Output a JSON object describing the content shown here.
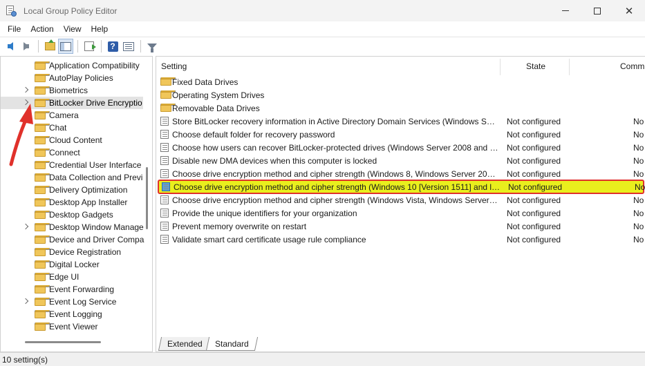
{
  "window": {
    "title": "Local Group Policy Editor",
    "controls": [
      "minimize",
      "maximize",
      "close"
    ]
  },
  "menu": [
    "File",
    "Action",
    "View",
    "Help"
  ],
  "toolbar": {
    "buttons": [
      "back-icon",
      "forward-icon",
      "up-folder-icon",
      "show-hide-tree-icon",
      "export-list-icon",
      "help-icon",
      "view-icon",
      "filter-icon"
    ]
  },
  "tree": {
    "items": [
      {
        "label": "Application Compatibility",
        "expandable": false
      },
      {
        "label": "AutoPlay Policies",
        "expandable": false
      },
      {
        "label": "Biometrics",
        "expandable": true
      },
      {
        "label": "BitLocker Drive Encryptio",
        "expandable": true,
        "selected": true
      },
      {
        "label": "Camera",
        "expandable": false
      },
      {
        "label": "Chat",
        "expandable": false
      },
      {
        "label": "Cloud Content",
        "expandable": false
      },
      {
        "label": "Connect",
        "expandable": false
      },
      {
        "label": "Credential User Interface",
        "expandable": false
      },
      {
        "label": "Data Collection and Previ",
        "expandable": false
      },
      {
        "label": "Delivery Optimization",
        "expandable": false
      },
      {
        "label": "Desktop App Installer",
        "expandable": false
      },
      {
        "label": "Desktop Gadgets",
        "expandable": false
      },
      {
        "label": "Desktop Window Manage",
        "expandable": true
      },
      {
        "label": "Device and Driver Compa",
        "expandable": false
      },
      {
        "label": "Device Registration",
        "expandable": false
      },
      {
        "label": "Digital Locker",
        "expandable": false
      },
      {
        "label": "Edge UI",
        "expandable": false
      },
      {
        "label": "Event Forwarding",
        "expandable": false
      },
      {
        "label": "Event Log Service",
        "expandable": true
      },
      {
        "label": "Event Logging",
        "expandable": false
      },
      {
        "label": "Event Viewer",
        "expandable": false
      }
    ]
  },
  "list": {
    "columns": {
      "setting": "Setting",
      "state": "State",
      "comment": "Comm"
    },
    "rows": [
      {
        "name": "Fixed Data Drives",
        "state": "",
        "comment": "",
        "type": "folder"
      },
      {
        "name": "Operating System Drives",
        "state": "",
        "comment": "",
        "type": "folder"
      },
      {
        "name": "Removable Data Drives",
        "state": "",
        "comment": "",
        "type": "folder"
      },
      {
        "name": "Store BitLocker recovery information in Active Directory Domain Services (Windows Serv...",
        "state": "Not configured",
        "comment": "No",
        "type": "setting"
      },
      {
        "name": "Choose default folder for recovery password",
        "state": "Not configured",
        "comment": "No",
        "type": "setting"
      },
      {
        "name": "Choose how users can recover BitLocker-protected drives (Windows Server 2008 and Wi...",
        "state": "Not configured",
        "comment": "No",
        "type": "setting"
      },
      {
        "name": "Disable new DMA devices when this computer is locked",
        "state": "Not configured",
        "comment": "No",
        "type": "setting"
      },
      {
        "name": "Choose drive encryption method and cipher strength (Windows 8, Windows Server 2012...",
        "state": "Not configured",
        "comment": "No",
        "type": "setting"
      },
      {
        "name": "Choose drive encryption method and cipher strength (Windows 10 [Version 1511] and la...",
        "state": "Not configured",
        "comment": "No",
        "type": "setting",
        "highlighted": true
      },
      {
        "name": "Choose drive encryption method and cipher strength (Windows Vista, Windows Server 2...",
        "state": "Not configured",
        "comment": "No",
        "type": "setting"
      },
      {
        "name": "Provide the unique identifiers for your organization",
        "state": "Not configured",
        "comment": "No",
        "type": "setting"
      },
      {
        "name": "Prevent memory overwrite on restart",
        "state": "Not configured",
        "comment": "No",
        "type": "setting"
      },
      {
        "name": "Validate smart card certificate usage rule compliance",
        "state": "Not configured",
        "comment": "No",
        "type": "setting"
      }
    ]
  },
  "tabs": [
    "Extended",
    "Standard"
  ],
  "status": "10 setting(s)",
  "colors": {
    "highlight": "#e9ef1d",
    "annotation": "#e0312b"
  }
}
